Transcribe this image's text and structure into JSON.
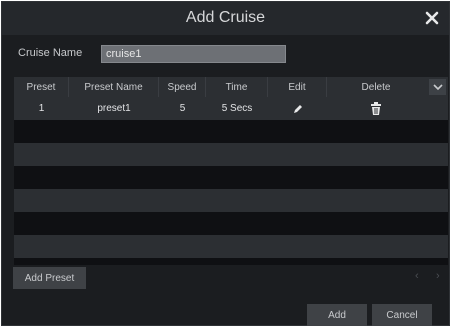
{
  "dialog": {
    "title": "Add Cruise"
  },
  "cruise_name": {
    "label": "Cruise Name",
    "value": "cruise1"
  },
  "table": {
    "columns": [
      "Preset",
      "Preset Name",
      "Speed",
      "Time",
      "Edit",
      "Delete"
    ],
    "rows": [
      {
        "preset": "1",
        "preset_name": "preset1",
        "speed": "5",
        "time": "5 Secs",
        "edit_icon": "pencil-icon",
        "delete_icon": "trash-icon"
      }
    ]
  },
  "buttons": {
    "add_preset": "Add Preset",
    "add": "Add",
    "cancel": "Cancel"
  },
  "pagination": {
    "prev": "‹",
    "next": "›"
  },
  "colors": {
    "background": "#1b1d20",
    "header": "#2c2f33",
    "input": "#6d7075"
  }
}
